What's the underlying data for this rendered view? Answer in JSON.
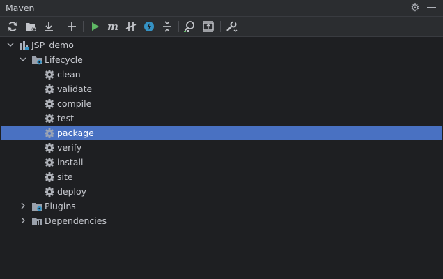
{
  "window": {
    "title": "Maven"
  },
  "toolbar": {
    "icons": [
      "reload-icon",
      "generate-sources-icon",
      "download-icon",
      "add-icon",
      "run-icon",
      "maven-goal-icon",
      "skip-tests-icon",
      "offline-icon",
      "collapse-icon",
      "analyze-icon",
      "expand-icon",
      "settings-wrench-icon"
    ],
    "accent_run": "#5fb865",
    "accent_offline": "#3592c4"
  },
  "tree": {
    "project": {
      "label": "JSP_demo",
      "icon": "maven-project-icon"
    },
    "lifecycle": {
      "label": "Lifecycle",
      "icon": "lifecycle-folder-icon",
      "goals": [
        "clean",
        "validate",
        "compile",
        "test",
        "package",
        "verify",
        "install",
        "site",
        "deploy"
      ],
      "selected": "package"
    },
    "plugins": {
      "label": "Plugins",
      "icon": "plugins-folder-icon"
    },
    "dependencies": {
      "label": "Dependencies",
      "icon": "dependencies-folder-icon"
    }
  },
  "colors": {
    "selection": "#4971c2",
    "background": "#1e1f22",
    "panel": "#2b2d30"
  }
}
